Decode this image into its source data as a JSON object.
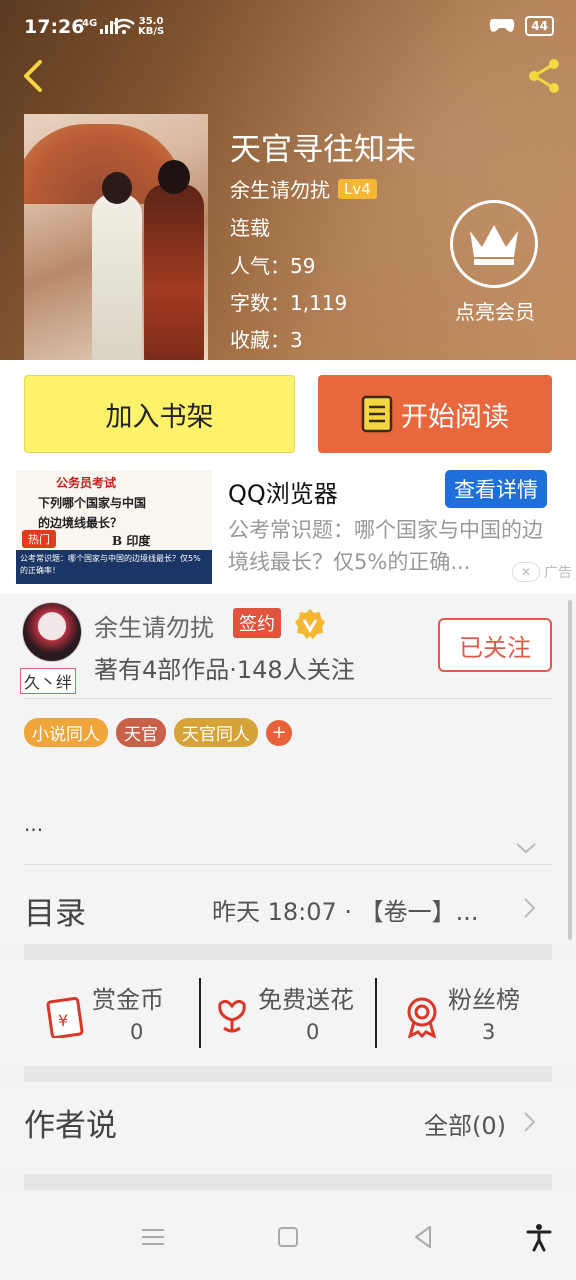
{
  "status_bar": {
    "time": "17:26",
    "network": "4G",
    "speed_value": "35.0",
    "speed_unit": "KB/S",
    "battery": "44"
  },
  "book": {
    "title": "天官寻往知未",
    "author": "余生请勿扰",
    "author_level": "Lv4",
    "status": "连载",
    "popularity": "人气：59",
    "word_count": "字数：1,119",
    "favorites": "收藏：3"
  },
  "vip": {
    "label": "点亮会员"
  },
  "actions": {
    "add_shelf": "加入书架",
    "start_read": "开始阅读"
  },
  "ad": {
    "image_title": "公务员考试",
    "image_q1": "下列哪个国家与中国",
    "image_q2": "的边境线最长？",
    "image_option": "B 印度",
    "image_hot": "热门",
    "image_caption": "公考常识题：哪个国家与中国的边境线最长？仅5%的正确率！",
    "title": "QQ浏览器",
    "button": "查看详情",
    "description": "公考常识题：哪个国家与中国的边境线最长？仅5%的正确...",
    "tag": "广告"
  },
  "author_card": {
    "name": "余生请勿扰",
    "sign_badge": "签约",
    "avatar_sign": "久丶绊",
    "stats": "著有4部作品·148人关注",
    "follow_button": "已关注"
  },
  "tags": [
    {
      "label": "小说同人",
      "color": "#f0a53a"
    },
    {
      "label": "天官",
      "color": "#c9614a"
    },
    {
      "label": "天官同人",
      "color": "#d6a338"
    }
  ],
  "intro": "...",
  "toc": {
    "label": "目录",
    "latest": "昨天 18:07 · 【卷一】..."
  },
  "rewards": [
    {
      "label": "赏金币",
      "count": "0"
    },
    {
      "label": "免费送花",
      "count": "0"
    },
    {
      "label": "粉丝榜",
      "count": "3"
    }
  ],
  "author_say": {
    "label": "作者说",
    "all": "全部(0)"
  },
  "colors": {
    "accent_orange": "#e8673c",
    "shelf_yellow": "#fef26a",
    "link_blue": "#1e6fd9",
    "follow_red": "#e05a48"
  }
}
